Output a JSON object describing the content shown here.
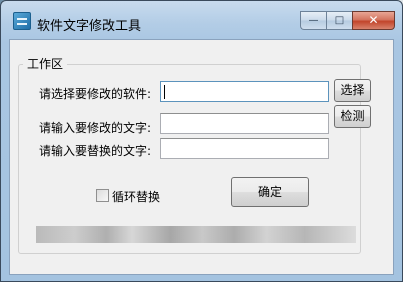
{
  "window": {
    "title": "软件文字修改工具",
    "minimize_symbol": "—",
    "maximize_symbol": "□",
    "close_symbol": "✕"
  },
  "group": {
    "title": "工作区"
  },
  "fields": {
    "software_label": "请选择要修改的软件:",
    "software_value": "",
    "modify_text_label": "请输入要修改的文字:",
    "modify_text_value": "",
    "replace_text_label": "请输入要替换的文字:",
    "replace_text_value": ""
  },
  "buttons": {
    "select_label": "选择",
    "detect_label": "检测",
    "confirm_label": "确定"
  },
  "options": {
    "loop_replace_label": "循环替换",
    "loop_replace_checked": false
  }
}
